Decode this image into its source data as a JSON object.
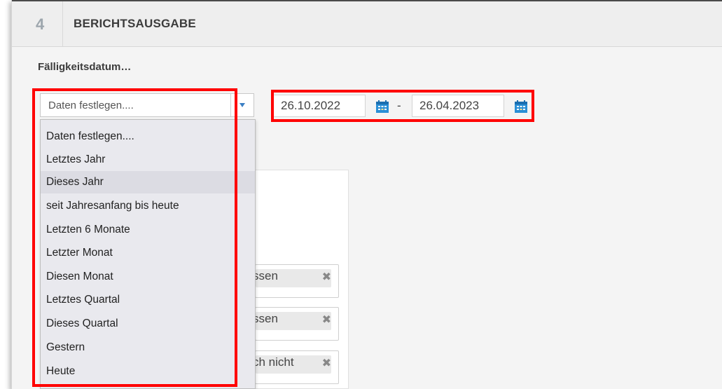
{
  "section": {
    "number": "4",
    "title": "BERICHTSAUSGABE"
  },
  "field": {
    "label": "Fälligkeitsdatum…"
  },
  "select": {
    "value": "Daten festlegen....",
    "options": [
      "Daten festlegen....",
      "Letztes Jahr",
      "Dieses Jahr",
      "seit Jahresanfang bis heute",
      "Letzten 6 Monate",
      "Letzter Monat",
      "Diesen Monat",
      "Letztes Quartal",
      "Dieses Quartal",
      "Gestern",
      "Heute"
    ],
    "highlighted_index": 2
  },
  "date_range": {
    "from": "26.10.2022",
    "separator": "-",
    "to": "26.04.2023"
  },
  "tags": [
    {
      "text": "ssen",
      "remove": "✖"
    },
    {
      "text": "ssen",
      "remove": "✖"
    },
    {
      "text": "ch nicht",
      "remove": "✖"
    }
  ],
  "colors": {
    "highlight_red": "#ff0000",
    "accent_blue": "#3b7fc4",
    "calendar_blue": "#2a8fd6"
  }
}
